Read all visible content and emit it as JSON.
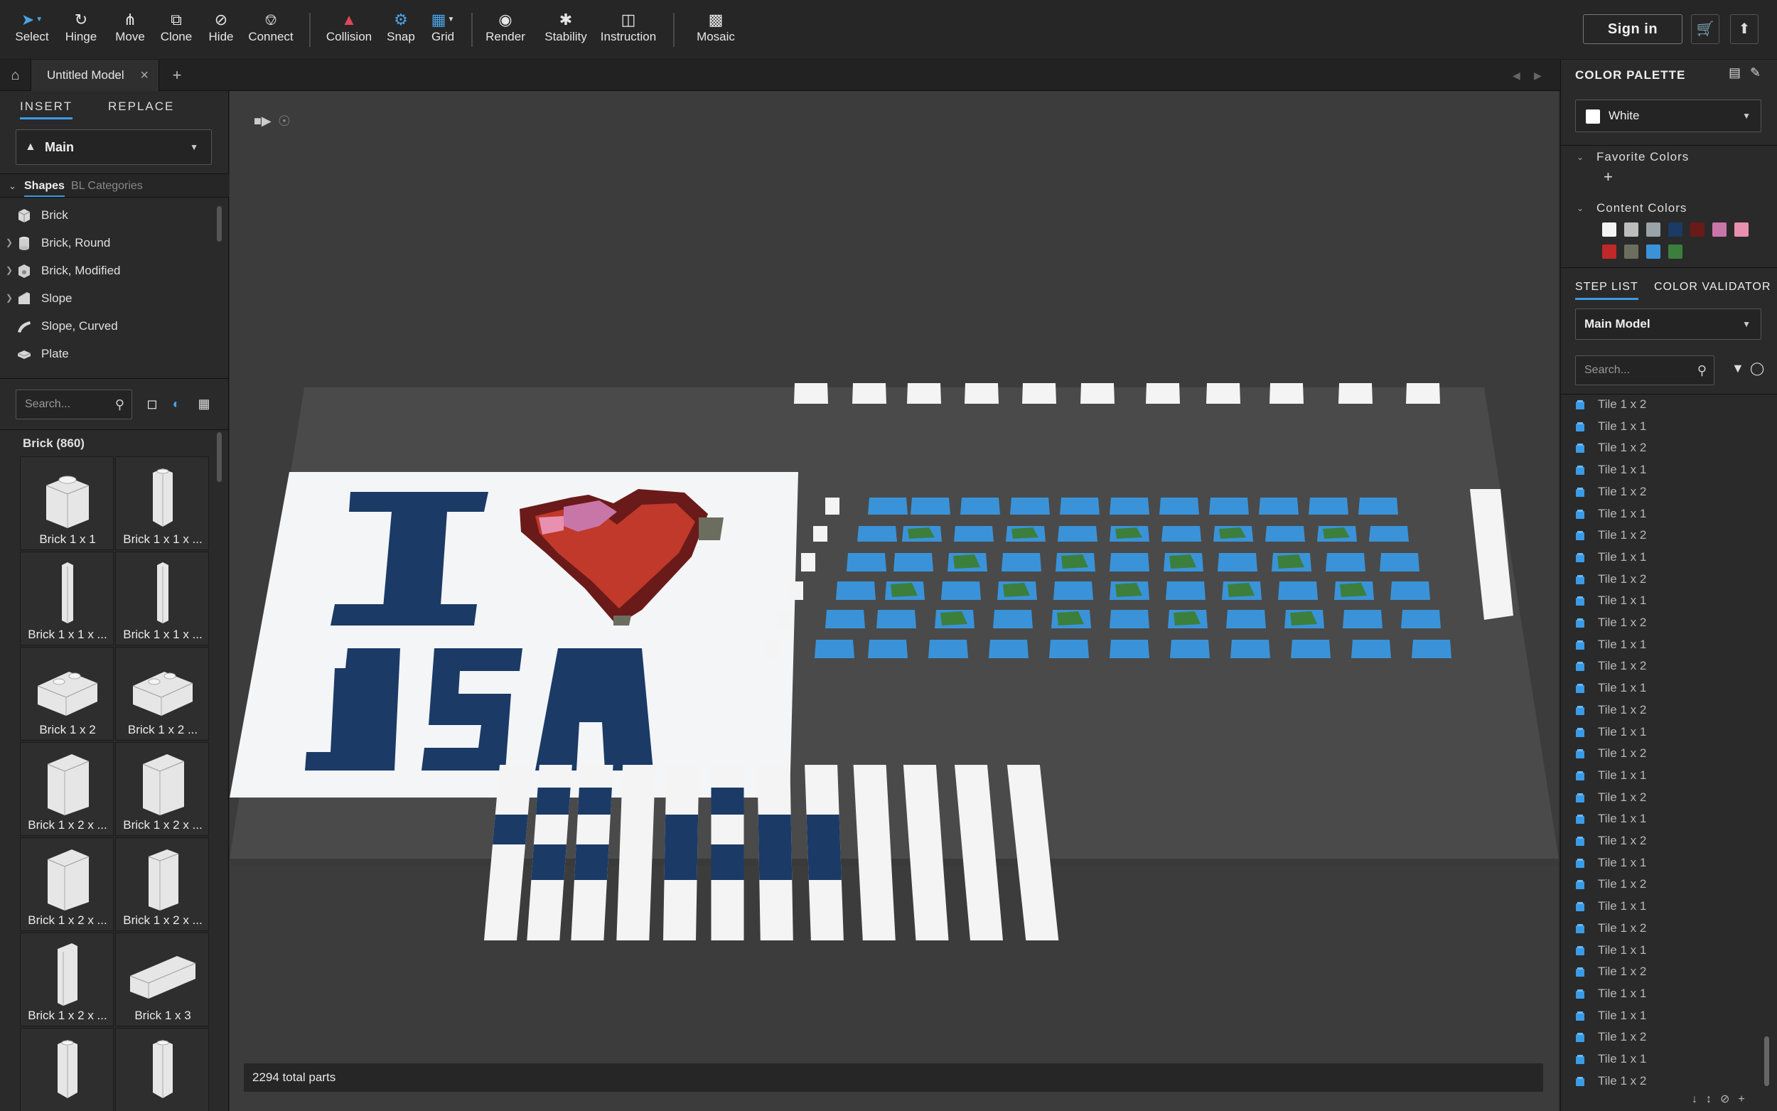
{
  "toolbar": {
    "tools": [
      {
        "label": "Select",
        "icon": "pointer-icon"
      },
      {
        "label": "Hinge",
        "icon": "hinge-icon"
      },
      {
        "label": "Move",
        "icon": "move-icon"
      },
      {
        "label": "Clone",
        "icon": "clone-icon"
      },
      {
        "label": "Hide",
        "icon": "hide-icon"
      },
      {
        "label": "Connect",
        "icon": "connect-icon"
      },
      {
        "label": "Collision",
        "icon": "collision-icon"
      },
      {
        "label": "Snap",
        "icon": "snap-icon"
      },
      {
        "label": "Grid",
        "icon": "grid-icon"
      },
      {
        "label": "Render",
        "icon": "camera-icon"
      },
      {
        "label": "Stability",
        "icon": "stability-icon"
      },
      {
        "label": "Instruction",
        "icon": "instruction-icon"
      },
      {
        "label": "Mosaic",
        "icon": "mosaic-icon"
      }
    ],
    "sign_in": "Sign in"
  },
  "tabs": {
    "model_tab": "Untitled Model"
  },
  "left_panel": {
    "tab_insert": "INSERT",
    "tab_replace": "REPLACE",
    "group_dropdown": "Main",
    "shapes_tab": "Shapes",
    "bl_tab": "BL Categories",
    "categories": [
      "Brick",
      "Brick, Round",
      "Brick, Modified",
      "Slope",
      "Slope, Curved",
      "Plate"
    ],
    "search_placeholder": "Search...",
    "group_title": "Brick (860)",
    "parts": [
      "Brick 1 x 1",
      "Brick 1 x 1 x ...",
      "Brick 1 x 1 x ...",
      "Brick 1 x 1 x ...",
      "Brick 1 x 2",
      "Brick 1 x 2 ...",
      "Brick 1 x 2 x ...",
      "Brick 1 x 2 x ...",
      "Brick 1 x 2 x ...",
      "Brick 1 x 2 x ...",
      "Brick 1 x 2 x ...",
      "Brick 1 x 3"
    ]
  },
  "viewport": {
    "status": "2294 total parts",
    "mosaic_text_top": "I",
    "mosaic_text_bottom": "ISA"
  },
  "right_panel": {
    "title": "COLOR PALETTE",
    "selected_color": "White",
    "favorite_colors": "Favorite Colors",
    "content_colors": "Content Colors",
    "content_swatches": [
      "#f4f4f4",
      "#bdbdbd",
      "#9aa3a8",
      "#1b3a66",
      "#6b1a1a",
      "#c875a8",
      "#e990b0",
      "#c0282a",
      "#6b6e5e",
      "#3a93d8",
      "#3c7f3c"
    ],
    "tab_step_list": "STEP LIST",
    "tab_color_validator": "COLOR VALIDATOR",
    "model_dropdown": "Main Model",
    "search_placeholder": "Search...",
    "steps": [
      "Tile 1 x 2",
      "Tile 1 x 1",
      "Tile 1 x 2",
      "Tile 1 x 1",
      "Tile 1 x 2",
      "Tile 1 x 1",
      "Tile 1 x 2",
      "Tile 1 x 1",
      "Tile 1 x 2",
      "Tile 1 x 1",
      "Tile 1 x 2",
      "Tile 1 x 1",
      "Tile 1 x 2",
      "Tile 1 x 1",
      "Tile 1 x 2",
      "Tile 1 x 1",
      "Tile 1 x 2",
      "Tile 1 x 1",
      "Tile 1 x 2",
      "Tile 1 x 1",
      "Tile 1 x 2",
      "Tile 1 x 1",
      "Tile 1 x 2",
      "Tile 1 x 1",
      "Tile 1 x 2",
      "Tile 1 x 1",
      "Tile 1 x 2",
      "Tile 1 x 1",
      "Tile 1 x 1",
      "Tile 1 x 2",
      "Tile 1 x 1",
      "Tile 1 x 2"
    ]
  },
  "colors": {
    "accent": "#3a9be6",
    "navy": "#1b3a66",
    "heart_red": "#c0392b"
  }
}
